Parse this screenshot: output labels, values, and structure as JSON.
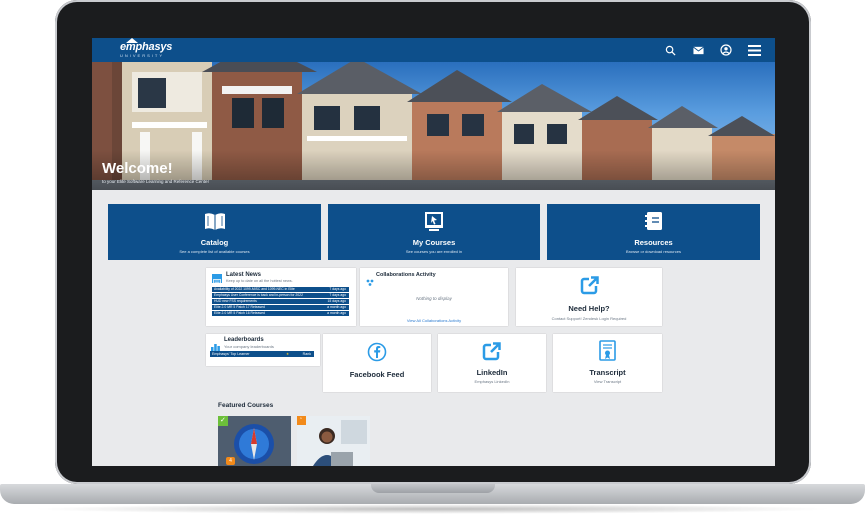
{
  "brand": {
    "logo_text": "emphasys",
    "logo_sub": "UNIVERSITY"
  },
  "nav": {
    "icons": [
      "search-icon",
      "mail-icon",
      "user-icon",
      "menu-icon"
    ]
  },
  "hero": {
    "title": "Welcome!",
    "subtitle": "to your Elite Software Learning and Reference Center"
  },
  "tiles": [
    {
      "title": "Catalog",
      "subtitle": "See a complete list of available courses",
      "icon": "book-icon"
    },
    {
      "title": "My Courses",
      "subtitle": "See courses you are enrolled in",
      "icon": "course-icon"
    },
    {
      "title": "Resources",
      "subtitle": "Browse or download resources",
      "icon": "notebook-icon"
    }
  ],
  "latest_news": {
    "title": "Latest News",
    "subtitle": "Keep up to date on all the hottest news.",
    "items": [
      {
        "text": "Availability of 2022 1099-MISC and 1099-NEC in Elite",
        "date": "7 days ago"
      },
      {
        "text": "Emphasys User Conference is back and in-person for 2022",
        "date": "7 days ago"
      },
      {
        "text": "HUD new FSS requirements",
        "date": "15 days ago"
      },
      {
        "text": "Elite 2.0 MR 5 Patch 17 Released",
        "date": "a month ago"
      },
      {
        "text": "Elite 2.0 MR 5 Patch 16 Released",
        "date": "a month ago"
      }
    ]
  },
  "collaborations": {
    "title": "Collaborations Activity",
    "empty": "Nothing to display",
    "link": "View All Collaborations Activity"
  },
  "need_help": {
    "title": "Need Help?",
    "subtitle": "Contact Support! Zendesk Login Required"
  },
  "leaderboards": {
    "title": "Leaderboards",
    "subtitle": "Your company leaderboards",
    "row_label": "Emphasys' Top Learner",
    "rank_label": "Rank"
  },
  "facebook": {
    "title": "Facebook Feed"
  },
  "linkedin": {
    "title": "LinkedIn",
    "subtitle": "Emphasys LinkedIn"
  },
  "transcript": {
    "title": "Transcript",
    "subtitle": "View Transcript"
  },
  "featured": {
    "title": "Featured Courses",
    "badge_count": "4"
  },
  "colors": {
    "primary": "#0d4f8b",
    "accent": "#2b9be6",
    "page_bg": "#e9eaec"
  }
}
